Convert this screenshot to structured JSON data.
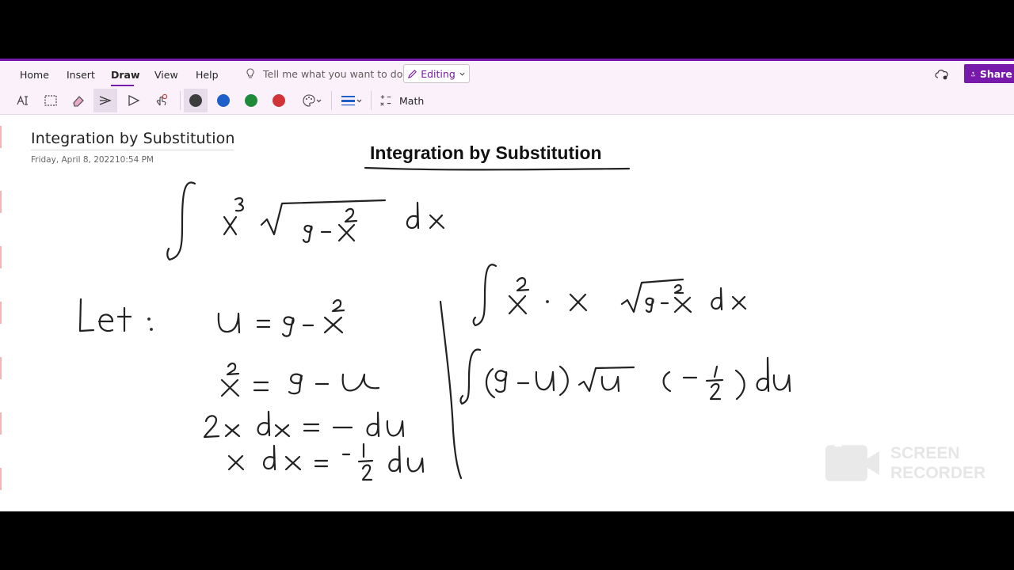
{
  "ribbon": {
    "tabs": [
      {
        "label": "Home"
      },
      {
        "label": "Insert"
      },
      {
        "label": "Draw"
      },
      {
        "label": "View"
      },
      {
        "label": "Help"
      }
    ],
    "active_tab": "Draw",
    "tell_me": "Tell me what you want to do",
    "editing_label": "Editing",
    "share_label": "Share",
    "math_label": "Math",
    "pen_colors": [
      "#3c3c3c",
      "#1f5fc9",
      "#1f8a3a",
      "#d13438"
    ],
    "accent_color": "#7719aa"
  },
  "page": {
    "title": "Integration by Substitution",
    "date": "Friday, April 8, 2022",
    "time": "10:54 PM",
    "ink_heading": "Integration by Substitution"
  },
  "watermark": {
    "line1": "SCREEN",
    "line2": "RECORDER"
  }
}
